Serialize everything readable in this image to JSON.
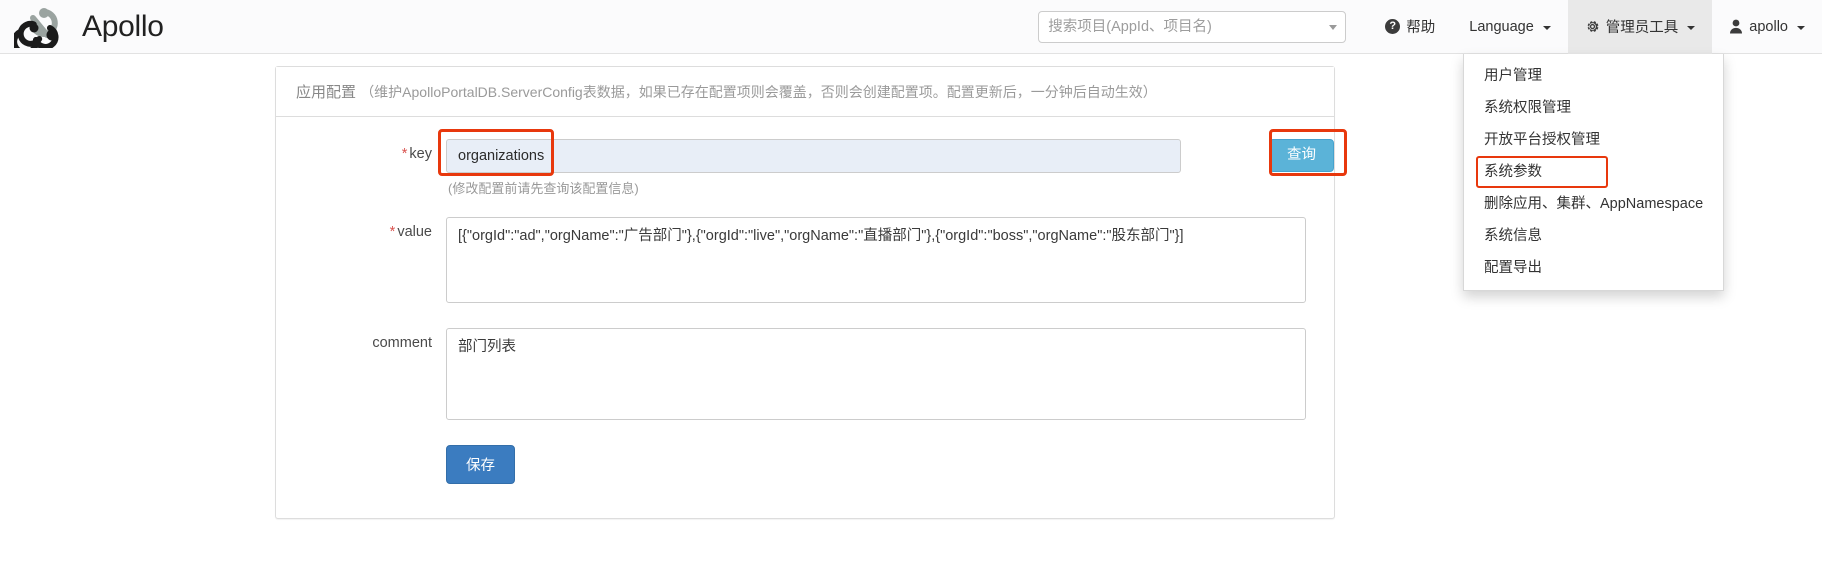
{
  "brand": {
    "name": "Apollo",
    "logo_icon": "apollo-logo-icon"
  },
  "navbar": {
    "search": {
      "placeholder": "搜索项目(AppId、项目名)",
      "value": "",
      "caret_icon": "chevron-down-icon"
    },
    "help": {
      "label": "帮助",
      "icon": "question-circle-icon"
    },
    "language": {
      "label": "Language",
      "caret_icon": "caret-down-icon"
    },
    "admin_tools": {
      "label": "管理员工具",
      "icon": "gear-icon",
      "caret_icon": "caret-down-icon"
    },
    "user": {
      "label": "apollo",
      "icon": "user-icon",
      "caret_icon": "caret-down-icon"
    }
  },
  "admin_menu": {
    "items": [
      {
        "label": "用户管理",
        "highlighted": false
      },
      {
        "label": "系统权限管理",
        "highlighted": false
      },
      {
        "label": "开放平台授权管理",
        "highlighted": false
      },
      {
        "label": "系统参数",
        "highlighted": true
      },
      {
        "label": "删除应用、集群、AppNamespace",
        "highlighted": false
      },
      {
        "label": "系统信息",
        "highlighted": false
      },
      {
        "label": "配置导出",
        "highlighted": false
      }
    ]
  },
  "panel": {
    "heading_title": "应用配置",
    "heading_sub": "（维护ApolloPortalDB.ServerConfig表数据，如果已存在配置项则会覆盖，否则会创建配置项。配置更新后，一分钟后自动生效）",
    "form": {
      "key": {
        "label": "key",
        "required_mark": "*",
        "value": "organizations",
        "helper": "(修改配置前请先查询该配置信息)"
      },
      "query_button": {
        "label": "查询"
      },
      "value": {
        "label": "value",
        "required_mark": "*",
        "value": "[{\"orgId\":\"ad\",\"orgName\":\"广告部门\"},{\"orgId\":\"live\",\"orgName\":\"直播部门\"},{\"orgId\":\"boss\",\"orgName\":\"股东部门\"}]"
      },
      "comment": {
        "label": "comment",
        "value": "部门列表"
      },
      "save_button": {
        "label": "保存"
      }
    }
  },
  "colors": {
    "query_button": "#5bb3d8",
    "save_button": "#3b7cc0",
    "annotation": "#e8380d",
    "required_mark": "#d9534f",
    "key_input_bg": "#e8eef7"
  }
}
